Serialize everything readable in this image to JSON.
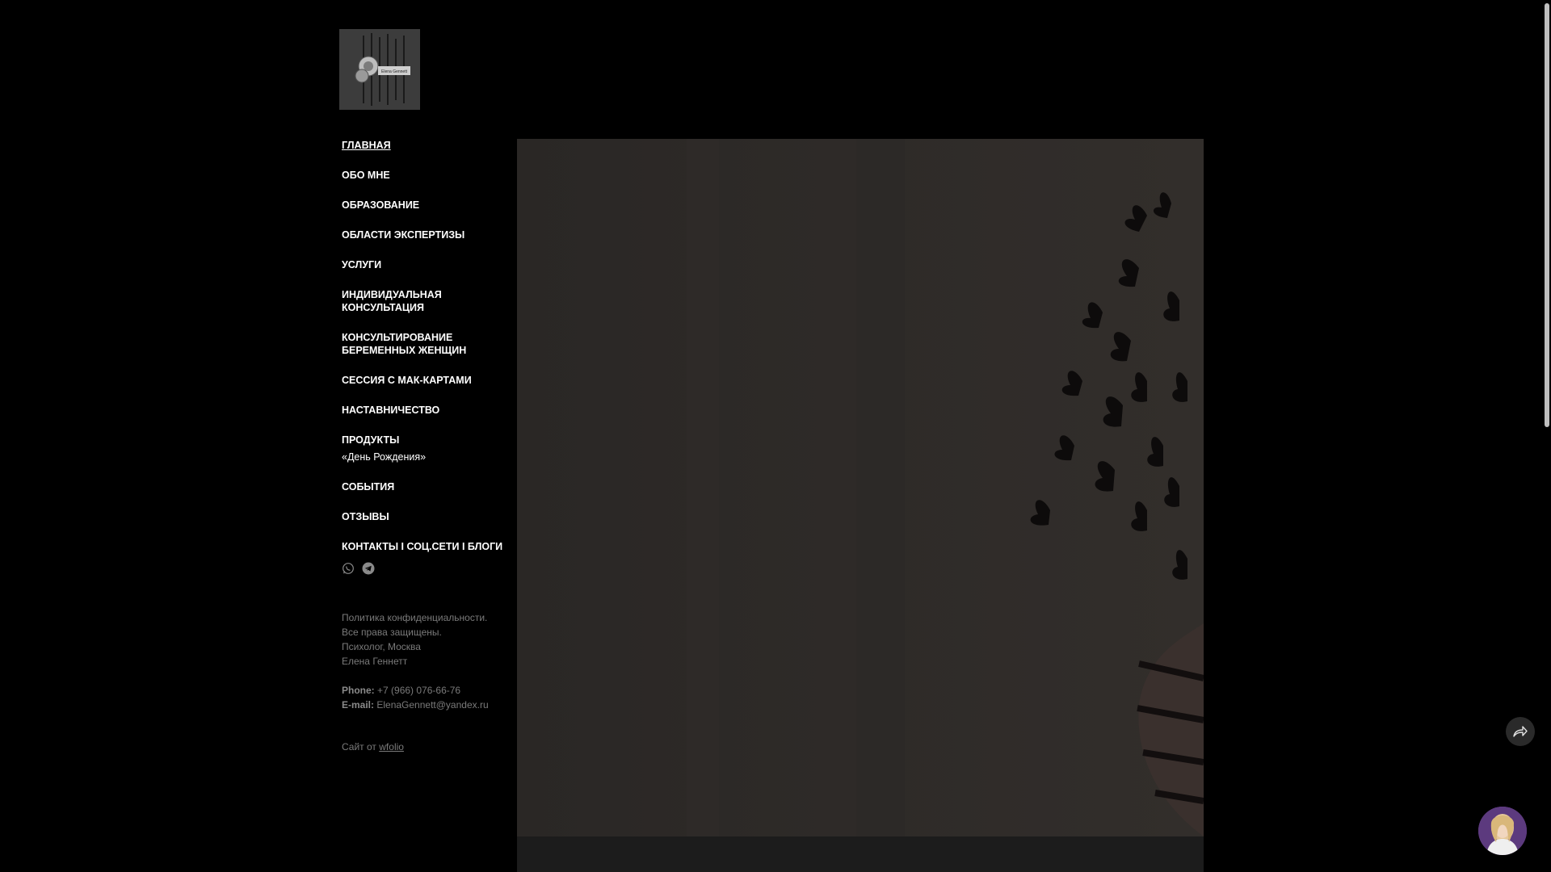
{
  "nav": {
    "items": [
      {
        "label": "ГЛАВНАЯ"
      },
      {
        "label": "ОБО МНЕ"
      },
      {
        "label": "ОБРАЗОВАНИЕ"
      },
      {
        "label": "ОБЛАСТИ ЭКСПЕРТИЗЫ"
      },
      {
        "label": "УСЛУГИ"
      },
      {
        "label": "ИНДИВИДУАЛЬНАЯ КОНСУЛЬТАЦИЯ"
      },
      {
        "label": "КОНСУЛЬТИРОВАНИЕ БЕРЕМЕННЫХ ЖЕНЩИН"
      },
      {
        "label": "СЕССИЯ С МАК-КАРТАМИ"
      },
      {
        "label": "НАСТАВНИЧЕСТВО"
      },
      {
        "label": "ПРОДУКТЫ"
      },
      {
        "label": "«День Рождения»"
      },
      {
        "label": "СОБЫТИЯ"
      },
      {
        "label": "ОТЗЫВЫ"
      },
      {
        "label": "КОНТАКТЫ I СОЦ.СЕТИ I БЛОГИ"
      }
    ],
    "active_label": "ГЛАВНАЯ"
  },
  "social": {
    "icons": [
      "whatsapp-icon",
      "telegram-icon"
    ]
  },
  "footer": {
    "lines": [
      "Политика конфиденциальности.",
      "Все права защищены.",
      "Психолог, Москва",
      "Елена Геннетт"
    ],
    "phone_label": "Phone:",
    "phone_value": "+7 (966) 076-66-76",
    "email_label": "E-mail:",
    "email_value": "ElenaGennett@yandex.ru",
    "credit_prefix": "Сайт от",
    "credit_link": "wfolio"
  },
  "logo": {
    "text": "Elena Gennett"
  },
  "colors": {
    "background": "#000000",
    "nav_text": "#ffffff",
    "muted_text": "#7a7a7a",
    "hero_bg": "#2d2a28"
  }
}
